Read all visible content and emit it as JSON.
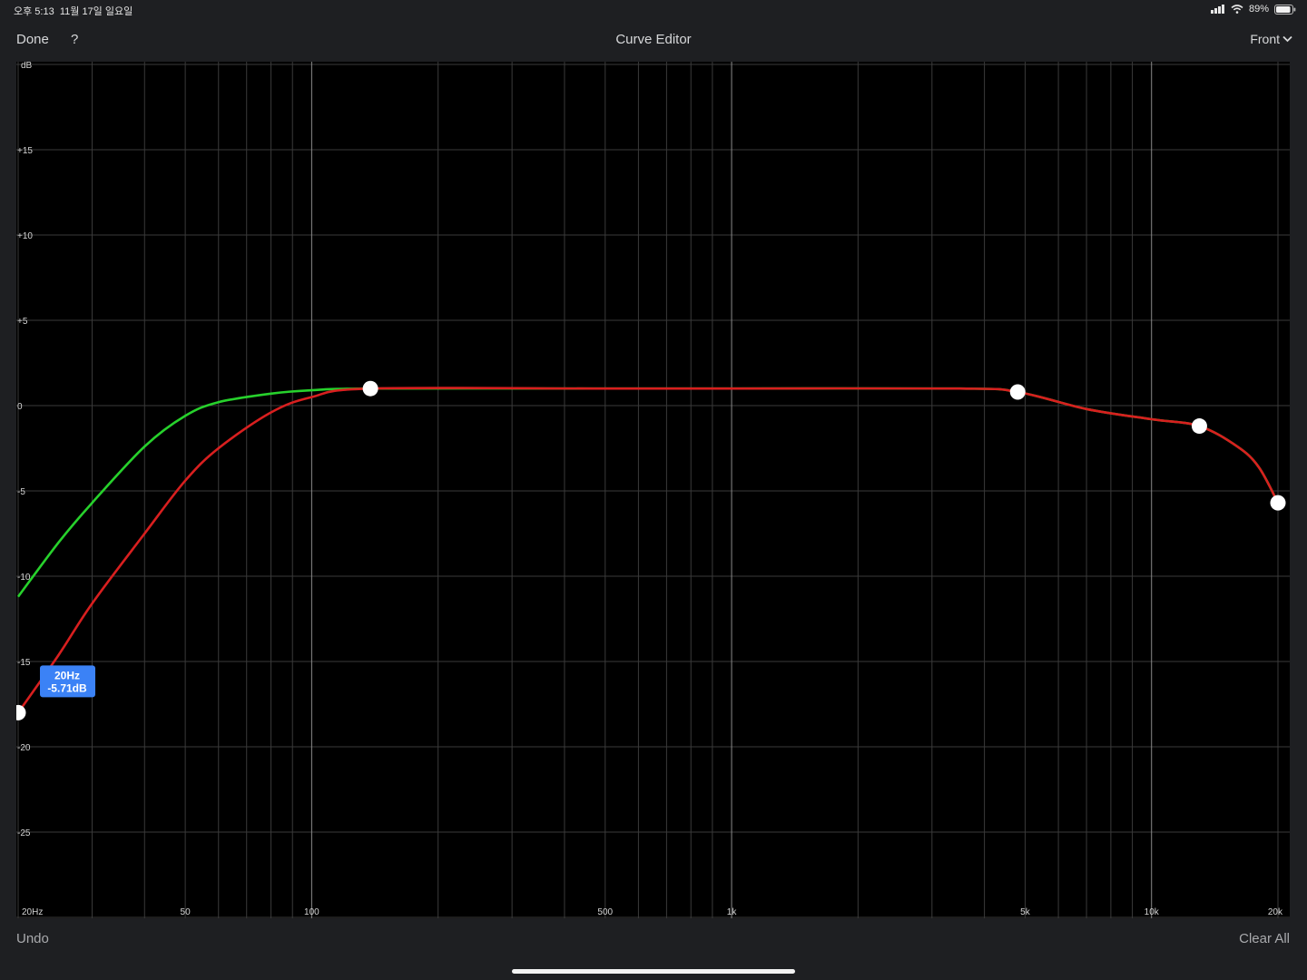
{
  "status": {
    "time": "오후 5:13",
    "date": "11월 17일 일요일",
    "battery": "89%"
  },
  "nav": {
    "done": "Done",
    "help": "?",
    "title": "Curve Editor",
    "front": "Front"
  },
  "bottom": {
    "undo": "Undo",
    "clear_all": "Clear All"
  },
  "colors": {
    "green_curve": "#27d12c",
    "red_curve": "#d81f1f",
    "tooltip": "#3b82f6"
  },
  "tooltip": {
    "line1": "20Hz",
    "line2": "-5.71dB"
  },
  "chart_data": {
    "type": "line",
    "xscale": "log",
    "xlim": [
      20,
      20000
    ],
    "ylim": [
      -30,
      20
    ],
    "ylabel": "dB",
    "yticks": [
      {
        "label": "+15",
        "value": 15
      },
      {
        "label": "+10",
        "value": 10
      },
      {
        "label": "+5",
        "value": 5
      },
      {
        "label": "0",
        "value": 0
      },
      {
        "label": "-5",
        "value": -5
      },
      {
        "label": "-10",
        "value": -10
      },
      {
        "label": "-15",
        "value": -15
      },
      {
        "label": "-20",
        "value": -20
      },
      {
        "label": "-25",
        "value": -25
      }
    ],
    "xticks": [
      {
        "label": "20Hz",
        "value": 20
      },
      {
        "label": "50",
        "value": 50
      },
      {
        "label": "100",
        "value": 100
      },
      {
        "label": "500",
        "value": 500
      },
      {
        "label": "1k",
        "value": 1000
      },
      {
        "label": "5k",
        "value": 5000
      },
      {
        "label": "10k",
        "value": 10000
      },
      {
        "label": "20k",
        "value": 20000
      }
    ],
    "series": [
      {
        "color": "green",
        "points": [
          [
            20,
            -11.2
          ],
          [
            25,
            -8
          ],
          [
            30,
            -5.7
          ],
          [
            40,
            -2.4
          ],
          [
            50,
            -0.6
          ],
          [
            60,
            0.2
          ],
          [
            80,
            0.7
          ],
          [
            100,
            0.9
          ],
          [
            138,
            1.0
          ],
          [
            500,
            1.0
          ],
          [
            1000,
            1.0
          ],
          [
            3500,
            1.0
          ],
          [
            4800,
            0.8
          ],
          [
            7000,
            -0.2
          ],
          [
            10000,
            -0.8
          ],
          [
            13000,
            -1.2
          ],
          [
            16000,
            -2.4
          ],
          [
            18000,
            -3.6
          ],
          [
            20000,
            -5.7
          ]
        ]
      },
      {
        "color": "red",
        "points": [
          [
            20,
            -18.0
          ],
          [
            25,
            -14.6
          ],
          [
            30,
            -11.6
          ],
          [
            40,
            -7.5
          ],
          [
            50,
            -4.4
          ],
          [
            60,
            -2.5
          ],
          [
            80,
            -0.4
          ],
          [
            100,
            0.5
          ],
          [
            138,
            1.0
          ],
          [
            500,
            1.0
          ],
          [
            1000,
            1.0
          ],
          [
            3500,
            1.0
          ],
          [
            4800,
            0.8
          ],
          [
            7000,
            -0.2
          ],
          [
            10000,
            -0.8
          ],
          [
            13000,
            -1.2
          ],
          [
            16000,
            -2.4
          ],
          [
            18000,
            -3.6
          ],
          [
            20000,
            -5.7
          ]
        ]
      }
    ],
    "control_points": [
      [
        20,
        -18.0
      ],
      [
        138,
        1.0
      ],
      [
        4800,
        0.8
      ],
      [
        13000,
        -1.2
      ],
      [
        20000,
        -5.7
      ]
    ]
  }
}
